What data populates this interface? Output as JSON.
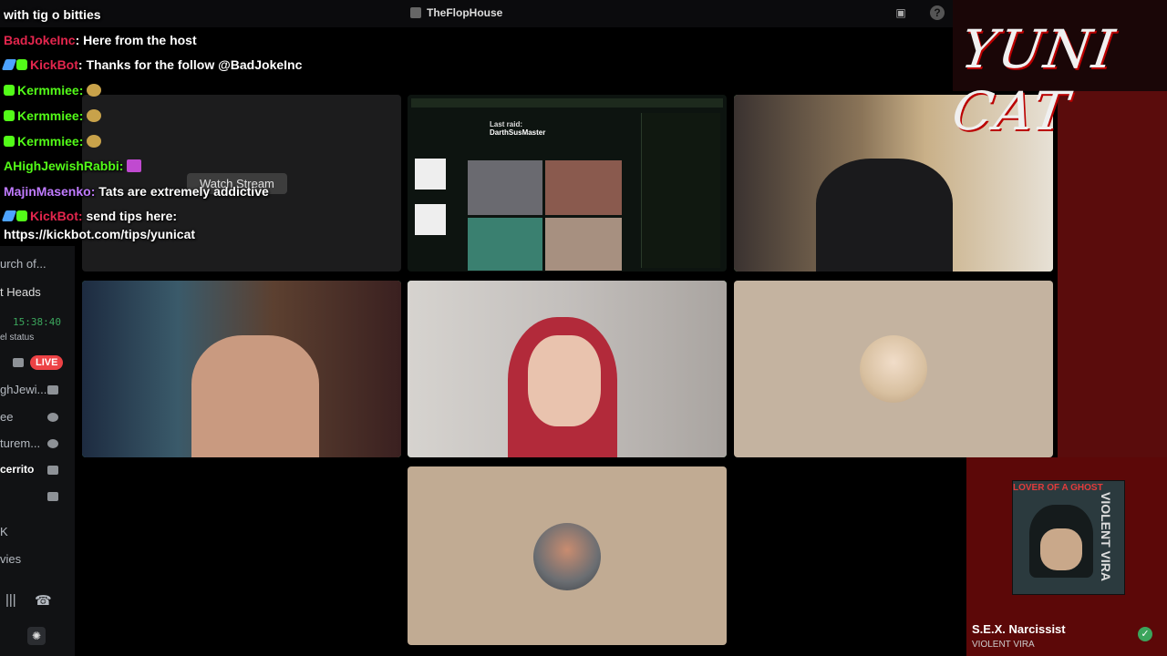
{
  "window": {
    "title": "TheFlopHouse"
  },
  "chat": {
    "line0": "with tig o bitties",
    "messages": [
      {
        "user": "BadJokeInc",
        "color": "#e3264d",
        "text": "Here from the host",
        "badges": 0
      },
      {
        "user": "KickBot",
        "color": "#e3264d",
        "text": "Thanks for the follow @BadJokeInc",
        "badges": 2
      },
      {
        "user": "Kermmiee",
        "color": "#53fc18",
        "text": "",
        "badges": 1,
        "emote": "frog"
      },
      {
        "user": "Kermmiee",
        "color": "#53fc18",
        "text": "",
        "badges": 1,
        "emote": "frog"
      },
      {
        "user": "Kermmiee",
        "color": "#53fc18",
        "text": "",
        "badges": 1,
        "emote": "frog"
      },
      {
        "user": "AHighJewishRabbi",
        "color": "#53fc18",
        "text": "",
        "badges": 0,
        "emote": "pink"
      },
      {
        "user": "MajinMasenko",
        "color": "#c07bff",
        "text": "Tats are extremely addictive",
        "badges": 0
      },
      {
        "user": "KickBot",
        "color": "#e3264d",
        "text": "send tips here:",
        "badges": 2
      }
    ],
    "tips_link": "https://kickbot.com/tips/yunicat"
  },
  "sidebar": {
    "search_text": "urch of...",
    "channel": "t Heads",
    "time": "15:38:40",
    "status": "el status",
    "live": "LIVE",
    "users": [
      "ghJewi...",
      "ee",
      "turem...",
      "cerrito"
    ],
    "bottom1": "K",
    "bottom2": "vies"
  },
  "tiles": {
    "watch_label": "Watch Stream",
    "stream_last_raid_label": "Last raid:",
    "stream_last_raid": "DarthSusMaster"
  },
  "overlay": {
    "logo": "YUNI CAT",
    "album_title": "LOVER OF A GHOST",
    "album_side": "VIOLENT VIRA",
    "song": "S.E.X. Narcissist",
    "artist": "VIOLENT VIRA"
  },
  "icons": [
    "app-icon",
    "inbox-icon",
    "help-icon",
    "minimize-icon",
    "maximize-icon",
    "close-icon",
    "mic-icon",
    "hangup-icon",
    "activity-icon",
    "check-icon"
  ]
}
